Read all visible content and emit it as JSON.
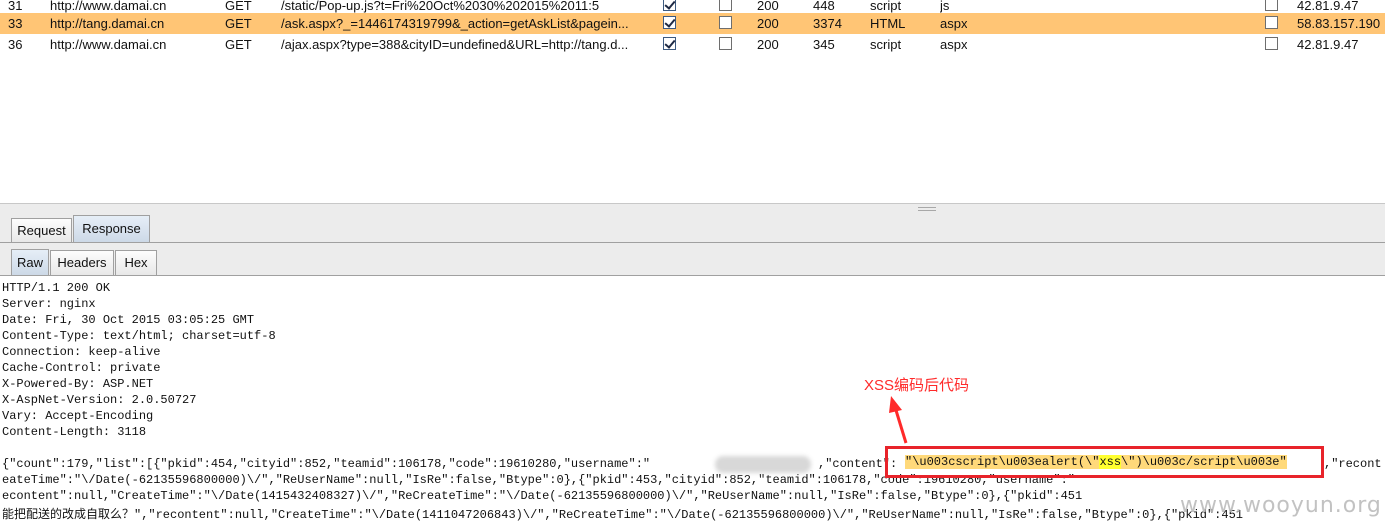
{
  "history": {
    "rows": [
      {
        "num": "31",
        "host": "http://www.damai.cn",
        "method": "GET",
        "url": "/static/Pop-up.js?t=Fri%20Oct%2030%202015%2011:5",
        "params": true,
        "edited": false,
        "status": "200",
        "length": "448",
        "mime": "script",
        "ext": "js",
        "comment": false,
        "ip": "42.81.9.47",
        "selected": false
      },
      {
        "num": "33",
        "host": "http://tang.damai.cn",
        "method": "GET",
        "url": "/ask.aspx?_=1446174319799&_action=getAskList&pagein...",
        "params": true,
        "edited": false,
        "status": "200",
        "length": "3374",
        "mime": "HTML",
        "ext": "aspx",
        "comment": false,
        "ip": "58.83.157.190",
        "selected": true
      },
      {
        "num": "36",
        "host": "http://www.damai.cn",
        "method": "GET",
        "url": "/ajax.aspx?type=388&cityID=undefined&URL=http://tang.d...",
        "params": true,
        "edited": false,
        "status": "200",
        "length": "345",
        "mime": "script",
        "ext": "aspx",
        "comment": false,
        "ip": "42.81.9.47",
        "selected": false
      }
    ]
  },
  "tabs": {
    "request": "Request",
    "response": "Response",
    "active": "Response"
  },
  "subtabs": {
    "raw": "Raw",
    "headers": "Headers",
    "hex": "Hex",
    "active": "Raw"
  },
  "response": {
    "headers": [
      "HTTP/1.1 200 OK",
      "Server: nginx",
      "Date: Fri, 30 Oct 2015 03:05:25 GMT",
      "Content-Type: text/html; charset=utf-8",
      "Connection: keep-alive",
      "Cache-Control: private",
      "X-Powered-By: ASP.NET",
      "X-AspNet-Version: 2.0.50727",
      "Vary: Accept-Encoding",
      "Content-Length: 3118"
    ],
    "body_lines": [
      "{\"count\":179,\"list\":[{\"pkid\":454,\"cityid\":852,\"teamid\":106178,\"code\":19610280,\"username\":\"",
      "eateTime\":\"\\/Date(-62135596800000)\\/\",\"ReUserName\":null,\"IsRe\":false,\"Btype\":0},{\"pkid\":453,\"cityid\":852,\"teamid\":106178,\"code\":19610280,\"username\":\"",
      "econtent\":null,\"CreateTime\":\"\\/Date(1415432408327)\\/\",\"ReCreateTime\":\"\\/Date(-62135596800000)\\/\",\"ReUserName\":null,\"IsRe\":false,\"Btype\":0},{\"pkid\":451",
      "能把配送的改成自取么？\",\"recontent\":null,\"CreateTime\":\"\\/Date(1411047206843)\\/\",\"ReCreateTime\":\"\\/Date(-62135596800000)\\/\",\"ReUserName\":null,\"IsRe\":false,\"Btype\":0},{\"pkid\":451"
    ],
    "body_line1_after": ",\"content\":",
    "body_line1_tail": ",\"recont",
    "xss_prefix": "\"\\u003cscript\\u003ealert(\\\"",
    "xss_word": "xss",
    "xss_suffix": "\\\")\\u003c/script\\u003e\""
  },
  "annotation": {
    "label": "XSS编码后代码",
    "color": "#ff2a2a"
  },
  "watermark": "www.wooyun.org",
  "colors": {
    "selected_row": "#ffc575",
    "highlight": "#ffd97a",
    "box": "#e8232a"
  }
}
